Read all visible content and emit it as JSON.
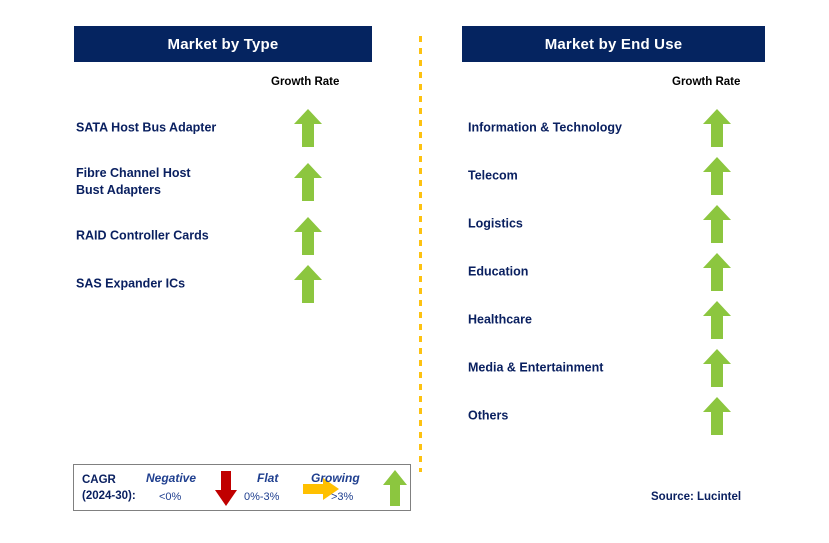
{
  "panels": [
    {
      "id": "type",
      "title": "Market by Type",
      "growth_rate_label": "Growth Rate",
      "rows": [
        {
          "label": "SATA Host Bus Adapter",
          "arrow": "up-arrow-icon",
          "trend": "Growing"
        },
        {
          "label": "Fibre Channel Host\nBust Adapters",
          "arrow": "up-arrow-icon",
          "trend": "Growing"
        },
        {
          "label": "RAID Controller Cards",
          "arrow": "up-arrow-icon",
          "trend": "Growing"
        },
        {
          "label": "SAS Expander ICs",
          "arrow": "up-arrow-icon",
          "trend": "Growing"
        }
      ]
    },
    {
      "id": "enduse",
      "title": "Market by End Use",
      "growth_rate_label": "Growth Rate",
      "rows": [
        {
          "label": "Information & Technology",
          "arrow": "up-arrow-icon",
          "trend": "Growing"
        },
        {
          "label": "Telecom",
          "arrow": "up-arrow-icon",
          "trend": "Growing"
        },
        {
          "label": "Logistics",
          "arrow": "up-arrow-icon",
          "trend": "Growing"
        },
        {
          "label": "Education",
          "arrow": "up-arrow-icon",
          "trend": "Growing"
        },
        {
          "label": "Healthcare",
          "arrow": "up-arrow-icon",
          "trend": "Growing"
        },
        {
          "label": "Media & Entertainment",
          "arrow": "up-arrow-icon",
          "trend": "Growing"
        },
        {
          "label": "Others",
          "arrow": "up-arrow-icon",
          "trend": "Growing"
        }
      ]
    }
  ],
  "legend": {
    "cagr_label": "CAGR\n(2024-30):",
    "items": [
      {
        "word": "Negative",
        "range": "<0%",
        "arrow": "down-arrow-icon",
        "color": "#C00000"
      },
      {
        "word": "Flat",
        "range": "0%-3%",
        "arrow": "right-arrow-icon",
        "color": "#FFC000"
      },
      {
        "word": "Growing",
        "range": ">3%",
        "arrow": "up-arrow-icon",
        "color": "#8CC63F"
      }
    ]
  },
  "source": "Source: Lucintel",
  "colors": {
    "header_bg": "#052460",
    "header_text": "#FFFFFF",
    "label_text": "#0A2060",
    "growing_green": "#8CC63F",
    "negative_red": "#C00000",
    "flat_orange": "#FFC000",
    "divider_dash": "#FDC211",
    "legend_border": "#808080"
  }
}
